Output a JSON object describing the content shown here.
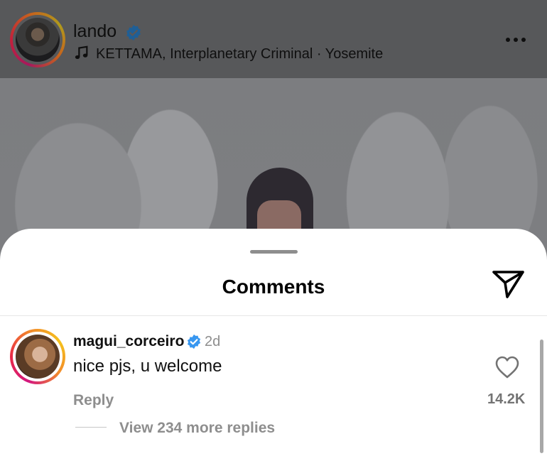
{
  "post": {
    "username": "lando",
    "music": "KETTAMA, Interplanetary Criminal · Yosemite",
    "icons": {
      "verified": "verified-badge-icon",
      "music": "music-note-icon",
      "more": "more-options-icon"
    }
  },
  "comments_sheet": {
    "title": "Comments",
    "share_icon": "send-icon"
  },
  "comments": [
    {
      "username": "magui_corceiro",
      "verified": true,
      "time": "2d",
      "text": "nice pjs, u welcome",
      "likes": "14.2K",
      "reply_label": "Reply",
      "view_replies_label": "View 234 more replies"
    }
  ],
  "colors": {
    "verified_blue": "#3897f0",
    "muted_text": "#8e8e8e"
  }
}
